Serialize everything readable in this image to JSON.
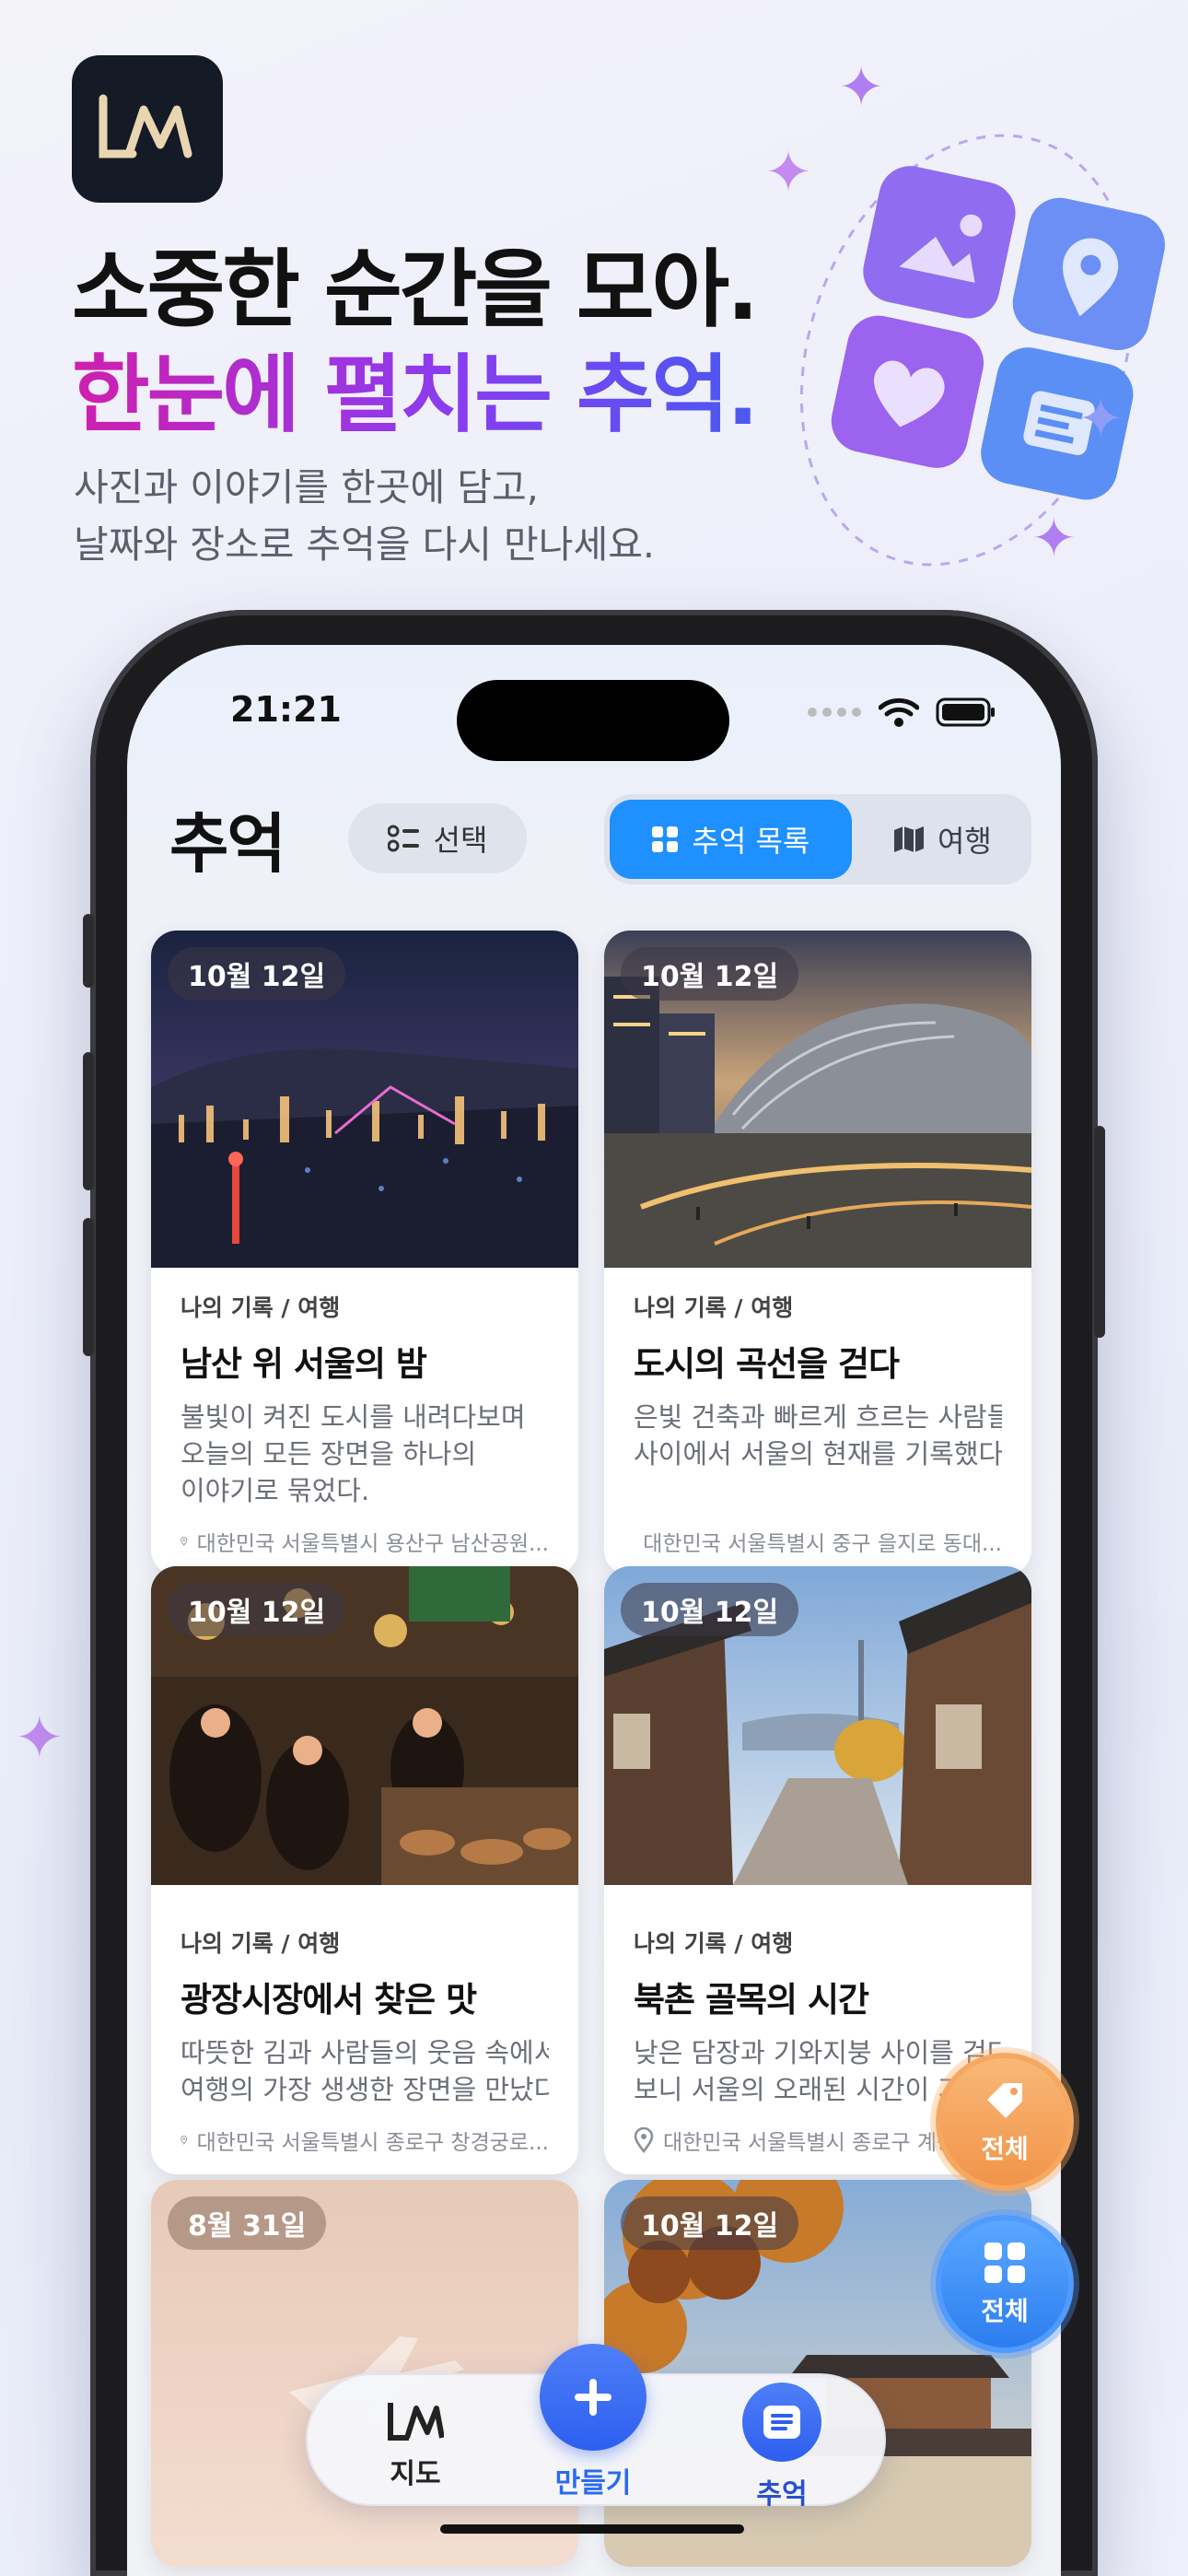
{
  "hero": {
    "logo_text": "LM",
    "title_line1": "소중한 순간을 모아.",
    "title_line2": "한눈에 펼치는 추억.",
    "subtitle_line1": "사진과 이야기를 한곳에 담고,",
    "subtitle_line2": "날짜와 장소로 추억을 다시 만나세요."
  },
  "status": {
    "time": "21:21"
  },
  "header": {
    "title": "추억",
    "select_label": "선택",
    "tabs": [
      {
        "label": "추억 목록",
        "active": true
      },
      {
        "label": "여행",
        "active": false
      }
    ]
  },
  "cards": [
    {
      "date": "10월 12일",
      "category": "나의 기록 / 여행",
      "title": "남산 위 서울의 밤",
      "desc": [
        "불빛이 켜진 도시를 내려다보며",
        "오늘의 모든 장면을 하나의",
        "이야기로 묶었다."
      ],
      "location": "대한민국 서울특별시 용산구 남산공원..."
    },
    {
      "date": "10월 12일",
      "category": "나의 기록 / 여행",
      "title": "도시의 곡선을 걷다",
      "desc": [
        "은빛 건축과 빠르게 흐르는 사람들",
        "사이에서 서울의 현재를 기록했다."
      ],
      "location": "대한민국 서울특별시 중구 을지로 동대..."
    },
    {
      "date": "10월 12일",
      "category": "나의 기록 / 여행",
      "title": "광장시장에서 찾은 맛",
      "desc": [
        "따뜻한 김과 사람들의 웃음 속에서",
        "여행의 가장 생생한 장면을 만났다."
      ],
      "location": "대한민국 서울특별시 종로구 창경궁로..."
    },
    {
      "date": "10월 12일",
      "category": "나의 기록 / 여행",
      "title": "북촌 골목의 시간",
      "desc": [
        "낮은 담장과 기와지붕 사이를 걷다",
        "보니 서울의 오래된 시간이 가까워졌다."
      ],
      "location": "대한민국 서울특별시 종로구 계동..."
    },
    {
      "date": "8월 31일"
    },
    {
      "date": "10월 12일"
    }
  ],
  "fabs": {
    "tag_label": "전체",
    "grid_label": "전체"
  },
  "tabbar": {
    "map": "지도",
    "make": "만들기",
    "memory": "추억"
  },
  "colors": {
    "accent": "#1e90ff",
    "gradient_start": "#d01fae",
    "gradient_end": "#2a66f2",
    "orange": "#f2944a"
  }
}
